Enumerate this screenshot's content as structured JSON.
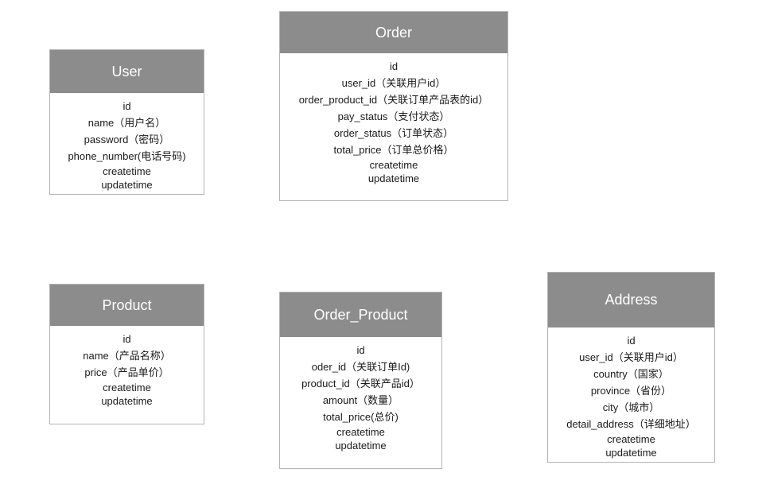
{
  "entities": {
    "user": {
      "title": "User",
      "fields": [
        "id",
        "name（用户名）",
        "password（密码）",
        "phone_number(电话号码)",
        "createtime",
        "updatetime"
      ]
    },
    "order": {
      "title": "Order",
      "fields": [
        "id",
        "user_id（关联用户id）",
        "order_product_id（关联订单产品表的id）",
        "pay_status（支付状态）",
        "order_status（订单状态）",
        "total_price（订单总价格）",
        "createtime",
        "updatetime"
      ]
    },
    "product": {
      "title": "Product",
      "fields": [
        "id",
        "name（产品名称）",
        "price（产品单价）",
        "createtime",
        "updatetime"
      ]
    },
    "order_product": {
      "title": "Order_Product",
      "fields": [
        "id",
        "oder_id（关联订单Id)",
        "product_id（关联产品id）",
        "amount（数量）",
        "total_price(总价)",
        "createtime",
        "updatetime"
      ]
    },
    "address": {
      "title": "Address",
      "fields": [
        "id",
        "user_id（关联用户id）",
        "country（国家）",
        "province（省份）",
        "city（城市）",
        "detail_address（详细地址）",
        "createtime",
        "updatetime"
      ]
    }
  },
  "colors": {
    "header_bg": "#8c8c8c",
    "header_text": "#ffffff",
    "border": "#b3b3b3",
    "text": "#1a1a1a"
  }
}
